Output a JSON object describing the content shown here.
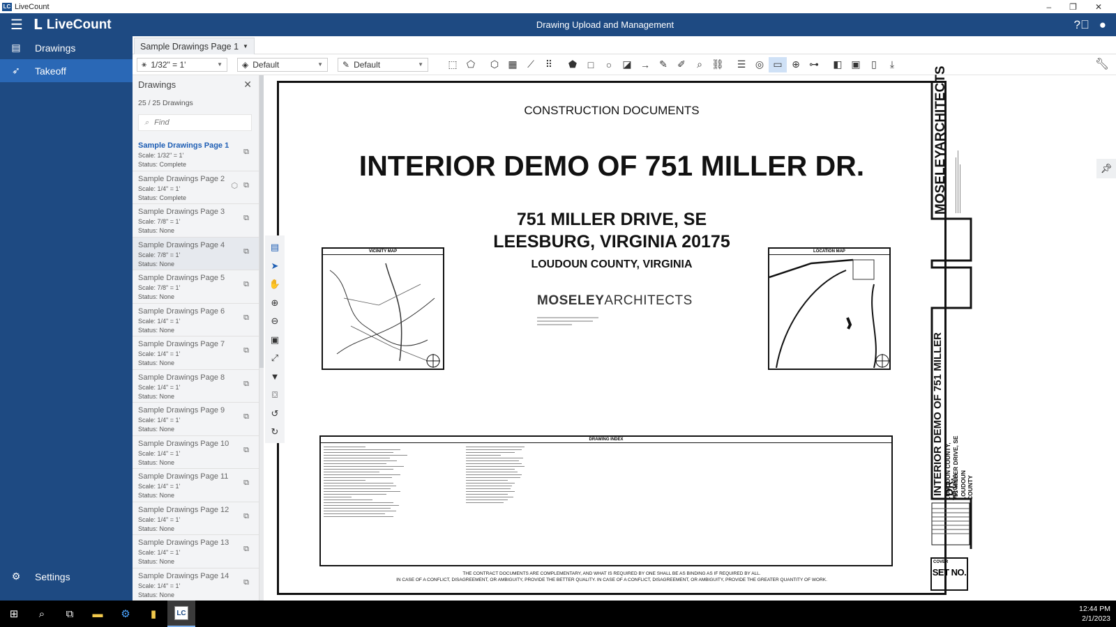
{
  "window": {
    "title": "LiveCount",
    "app_logo": "LC"
  },
  "header": {
    "brand": "LiveCount",
    "title": "Drawing Upload and Management"
  },
  "nav": {
    "items": [
      {
        "label": "Drawings",
        "icon": "drawings-icon"
      },
      {
        "label": "Takeoff",
        "icon": "rocket-icon"
      }
    ],
    "settings_label": "Settings"
  },
  "tab": {
    "label": "Sample Drawings Page 1"
  },
  "toolbar": {
    "scale": "1/32\" = 1'",
    "layer": "Default",
    "style": "Default"
  },
  "panel": {
    "title": "Drawings",
    "count": "25 / 25 Drawings",
    "find_placeholder": "Find",
    "drawings": [
      {
        "name": "Sample Drawings Page 1",
        "scale": "Scale: 1/32\" = 1'",
        "status": "Status: Complete"
      },
      {
        "name": "Sample Drawings Page 2",
        "scale": "Scale: 1/4\" = 1'",
        "status": "Status: Complete"
      },
      {
        "name": "Sample Drawings Page 3",
        "scale": "Scale: 7/8\" = 1'",
        "status": "Status: None"
      },
      {
        "name": "Sample Drawings Page 4",
        "scale": "Scale: 7/8\" = 1'",
        "status": "Status: None"
      },
      {
        "name": "Sample Drawings Page 5",
        "scale": "Scale: 7/8\" = 1'",
        "status": "Status: None"
      },
      {
        "name": "Sample Drawings Page 6",
        "scale": "Scale: 1/4\" = 1'",
        "status": "Status: None"
      },
      {
        "name": "Sample Drawings Page 7",
        "scale": "Scale: 1/4\" = 1'",
        "status": "Status: None"
      },
      {
        "name": "Sample Drawings Page 8",
        "scale": "Scale: 1/4\" = 1'",
        "status": "Status: None"
      },
      {
        "name": "Sample Drawings Page 9",
        "scale": "Scale: 1/4\" = 1'",
        "status": "Status: None"
      },
      {
        "name": "Sample Drawings Page 10",
        "scale": "Scale: 1/4\" = 1'",
        "status": "Status: None"
      },
      {
        "name": "Sample Drawings Page 11",
        "scale": "Scale: 1/4\" = 1'",
        "status": "Status: None"
      },
      {
        "name": "Sample Drawings Page 12",
        "scale": "Scale: 1/4\" = 1'",
        "status": "Status: None"
      },
      {
        "name": "Sample Drawings Page 13",
        "scale": "Scale: 1/4\" = 1'",
        "status": "Status: None"
      },
      {
        "name": "Sample Drawings Page 14",
        "scale": "Scale: 1/4\" = 1'",
        "status": "Status: None"
      }
    ]
  },
  "sheet": {
    "heading": "CONSTRUCTION DOCUMENTS",
    "title": "INTERIOR DEMO OF 751 MILLER DR.",
    "address_line1": "751 MILLER DRIVE, SE",
    "address_line2": "LEESBURG, VIRGINIA 20175",
    "county": "LOUDOUN COUNTY, VIRGINIA",
    "firm_bold": "MOSELEY",
    "firm_light": "ARCHITECTS",
    "vicinity_label": "VICINITY MAP",
    "location_label": "LOCATION MAP",
    "index_label": "DRAWING INDEX",
    "note_line1": "THE CONTRACT DOCUMENTS ARE COMPLEMENTARY, AND WHAT IS REQUIRED BY ONE SHALL BE AS BINDING AS IF REQUIRED BY ALL.",
    "note_line2": "IN CASE OF A CONFLICT, DISAGREEMENT, OR AMBIGUITY, PROVIDE THE BETTER QUALITY.  IN CASE OF A CONFLICT, DISAGREEMENT, OR AMBIGUITY, PROVIDE THE GREATER QUANTITY OF WORK.",
    "tb_firm": "MOSELEYARCHITECTS",
    "tb_title": "INTERIOR DEMO OF 751 MILLER DR.",
    "tb_sub1": "LOUDOUN COUNTY, VIRGINIA",
    "tb_sub2": "751 MILLER DRIVE, SE",
    "tb_sub3": "LOUDOUN COUNTY",
    "cover_label": "COVER",
    "set_no": "SET NO."
  },
  "taskbar": {
    "lc_label": "LC",
    "time": "12:44 PM",
    "date": "2/1/2023"
  }
}
